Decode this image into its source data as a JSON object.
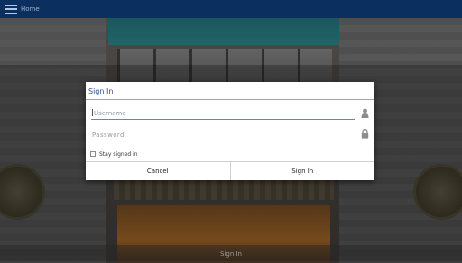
{
  "action_bar": {
    "title": "Home",
    "menu_icon": "menu-icon",
    "color": "#0b3060"
  },
  "dialog": {
    "title": "Sign In",
    "title_color": "#2e4f86",
    "username": {
      "value": "",
      "placeholder": "Username",
      "icon": "person-icon"
    },
    "password": {
      "value": "",
      "placeholder": "Password",
      "icon": "lock-icon"
    },
    "stay_signed_in": {
      "label": "Stay signed in",
      "checked": false
    },
    "buttons": {
      "cancel": "Cancel",
      "sign_in": "Sign In"
    }
  },
  "bottom_bar": {
    "label": "Sign In"
  }
}
